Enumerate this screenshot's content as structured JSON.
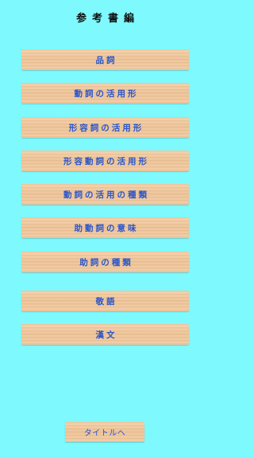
{
  "header": {
    "title": "参考書編"
  },
  "menu": {
    "items": [
      {
        "label": "品詞"
      },
      {
        "label": "動詞の活用形"
      },
      {
        "label": "形容詞の活用形"
      },
      {
        "label": "形容動詞の活用形"
      },
      {
        "label": "動詞の活用の種類"
      },
      {
        "label": "助動詞の意味"
      },
      {
        "label": "助詞の種類"
      },
      {
        "label": "敬語"
      },
      {
        "label": "漢文"
      }
    ]
  },
  "footer": {
    "back_label": "タイトルへ"
  }
}
